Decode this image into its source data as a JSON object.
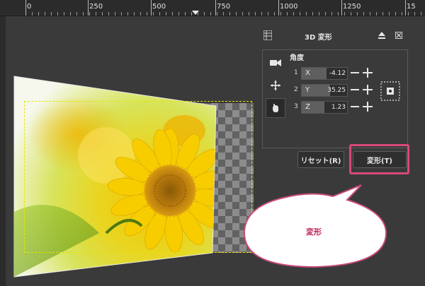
{
  "ruler": {
    "labels": [
      "0",
      "250",
      "500",
      "750",
      "1000",
      "1250",
      "15"
    ]
  },
  "panel": {
    "title": "3D 変形",
    "angle_label": "角度",
    "axes": [
      {
        "index": "1",
        "axis": "X",
        "value": "-4.12",
        "fill": 0.55
      },
      {
        "index": "2",
        "axis": "Y",
        "value": "35.25",
        "fill": 0.62
      },
      {
        "index": "3",
        "axis": "Z",
        "value": "1.23",
        "fill": 0.5
      }
    ],
    "tools": [
      "camera-icon",
      "move-icon",
      "rotate-hand-icon"
    ],
    "reset_label": "リセット(R)",
    "transform_label": "変形(T)"
  },
  "callout": {
    "text": "変形"
  },
  "colors": {
    "accent": "#d9487a",
    "selection": "#e6e600",
    "panel_bg": "#3a3a3a"
  }
}
